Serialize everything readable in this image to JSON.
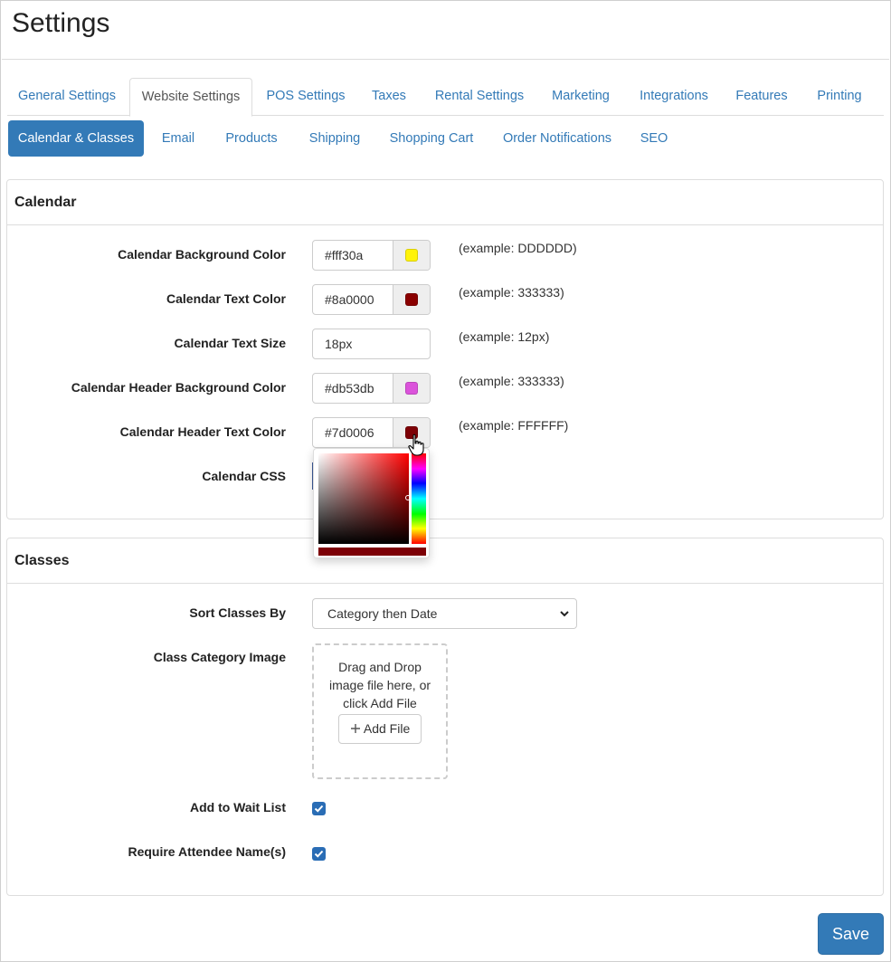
{
  "page": {
    "title": "Settings"
  },
  "main_tabs": [
    "General Settings",
    "Website Settings",
    "POS Settings",
    "Taxes",
    "Rental Settings",
    "Marketing",
    "Integrations",
    "Features",
    "Printing"
  ],
  "main_tab_active": "Website Settings",
  "sub_tabs": [
    "Calendar & Classes",
    "Email",
    "Products",
    "Shipping",
    "Shopping Cart",
    "Order Notifications",
    "SEO"
  ],
  "sub_tab_active": "Calendar & Classes",
  "calendar": {
    "heading": "Calendar",
    "bg_color": {
      "label": "Calendar Background Color",
      "value": "#fff30a",
      "swatch": "#fff30a",
      "example": "(example: DDDDDD)"
    },
    "text_color": {
      "label": "Calendar Text Color",
      "value": "#8a0000",
      "swatch": "#8a0000",
      "example": "(example: 333333)"
    },
    "text_size": {
      "label": "Calendar Text Size",
      "value": "18px",
      "example": "(example: 12px)"
    },
    "header_bg_color": {
      "label": "Calendar Header Background Color",
      "value": "#db53db",
      "swatch": "#db53db",
      "example": "(example: 333333)"
    },
    "header_text_color": {
      "label": "Calendar Header Text Color",
      "value": "#7d0006",
      "swatch": "#7d0006",
      "example": "(example: FFFFFF)"
    },
    "css": {
      "label": "Calendar CSS"
    }
  },
  "color_picker": {
    "hue_color": "#ff0000",
    "preview_color": "#7d0006"
  },
  "classes": {
    "heading": "Classes",
    "sort_by": {
      "label": "Sort Classes By",
      "selected": "Category then Date"
    },
    "category_image": {
      "label": "Class Category Image",
      "drop_text_1": "Drag and Drop",
      "drop_text_2": "image file here, or",
      "drop_text_3": "click Add File",
      "add_button": "Add File"
    },
    "wait_list": {
      "label": "Add to Wait List",
      "checked": true
    },
    "attendee_name": {
      "label": "Require Attendee Name(s)",
      "checked": true
    }
  },
  "save_button": "Save",
  "accent_color": "#337ab7"
}
